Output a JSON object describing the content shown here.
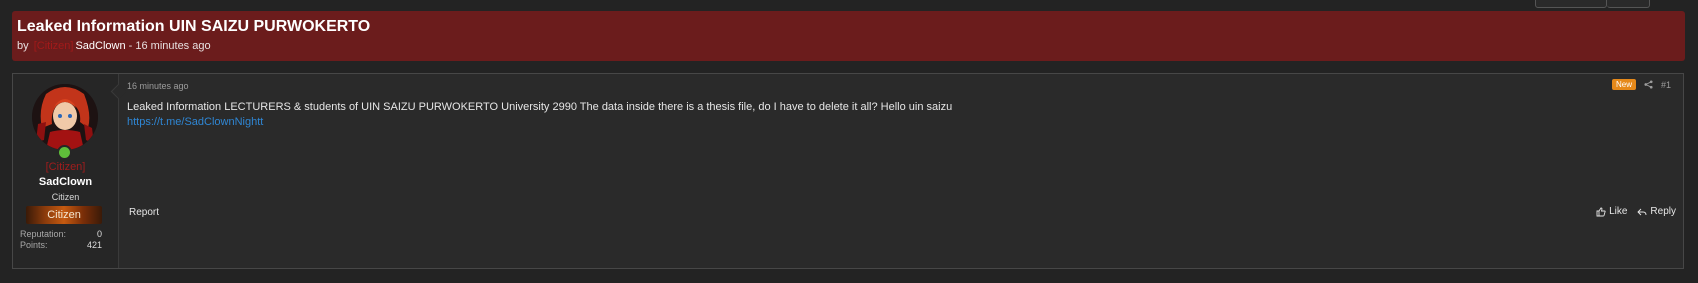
{
  "thread": {
    "title": "Leaked Information UIN SAIZU PURWOKERTO",
    "by_label": "by",
    "author_prefix": "[Citizen]",
    "author": "SadClown",
    "separator": "-",
    "time": "16 minutes ago"
  },
  "user": {
    "prefix": "[Citizen]",
    "name": "SadClown",
    "title": "Citizen",
    "banner": "Citizen",
    "stats": [
      {
        "label": "Reputation:",
        "value": "0"
      },
      {
        "label": "Points:",
        "value": "421"
      }
    ]
  },
  "post": {
    "date": "16 minutes ago",
    "badge": "New",
    "number": "#1",
    "text": "Leaked Information LECTURERS & students of UIN SAIZU PURWOKERTO University 2990 The data inside there is a thesis file, do I have to delete it all? Hello uin saizu",
    "link": "https://t.me/SadClownNightt",
    "report_label": "Report",
    "like_label": "Like",
    "reply_label": "Reply"
  },
  "colors": {
    "header_bg": "#6b1c1c",
    "prefix_red": "#a01d1d",
    "link_blue": "#2f86d3",
    "badge_orange": "#e6891a",
    "online_green": "#5fbf3a"
  },
  "icons": [
    "share-icon",
    "like-icon",
    "reply-icon",
    "online-status-icon"
  ]
}
